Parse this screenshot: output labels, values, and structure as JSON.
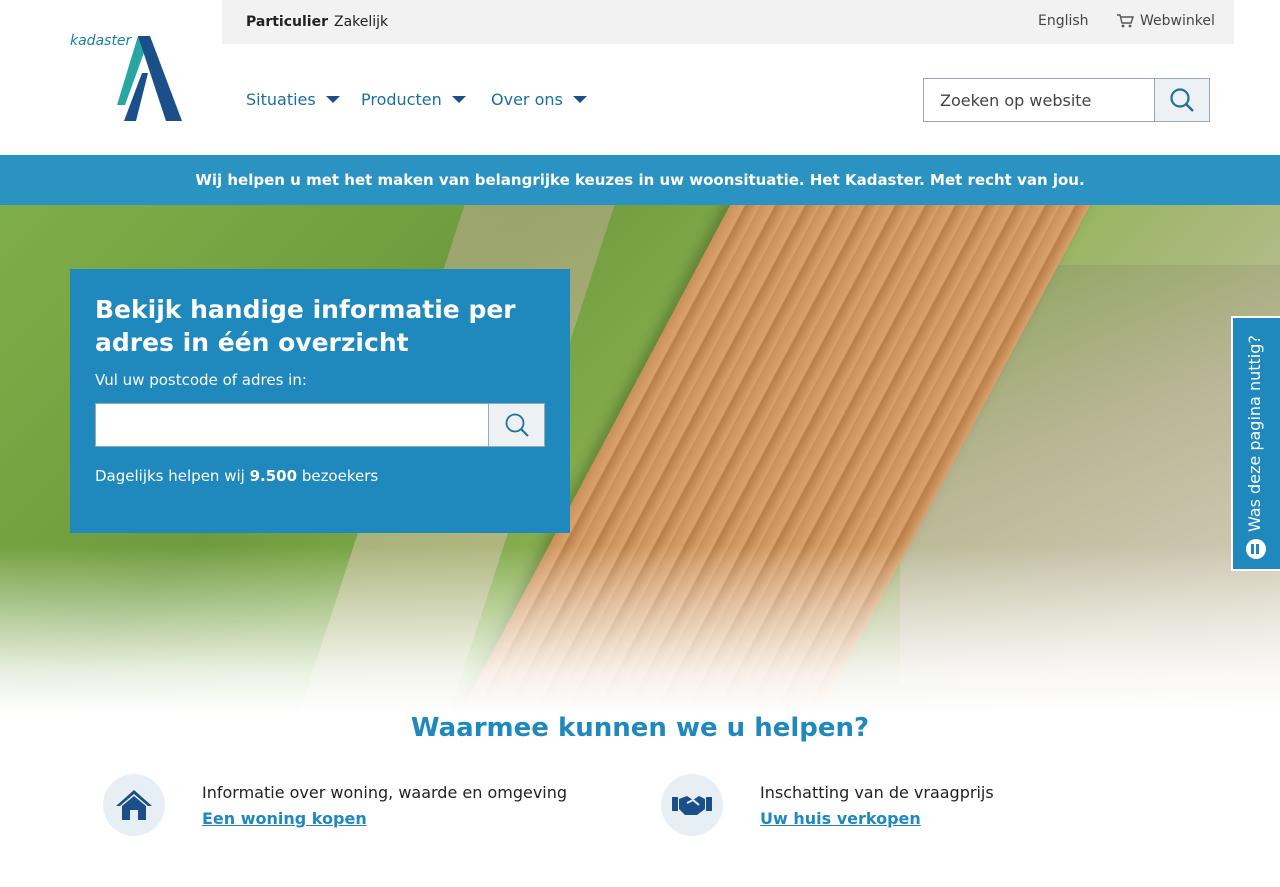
{
  "topbar": {
    "particulier": "Particulier",
    "zakelijk": "Zakelijk",
    "english": "English",
    "webwinkel": "Webwinkel"
  },
  "logo": {
    "text": "kadaster"
  },
  "nav": {
    "items": [
      {
        "label": "Situaties"
      },
      {
        "label": "Producten"
      },
      {
        "label": "Over ons"
      }
    ]
  },
  "search": {
    "placeholder": "Zoeken op website"
  },
  "banner": {
    "text": "Wij helpen u met het maken van belangrijke keuzes in uw woonsituatie. Het Kadaster. Met recht van jou."
  },
  "hero_card": {
    "title": "Bekijk handige informatie per adres in één overzicht",
    "label": "Vul uw postcode of adres in:",
    "input_value": "",
    "stats_prefix": "Dagelijks helpen wij",
    "stats_number": "9.500",
    "stats_suffix": "bezoekers"
  },
  "feedback": {
    "label": "Was deze pagina nuttig?"
  },
  "help": {
    "title": "Waarmee kunnen we u helpen?",
    "items": [
      {
        "icon": "house-icon",
        "description": "Informatie over woning, waarde en omgeving",
        "link": "Een woning kopen"
      },
      {
        "icon": "handshake-icon",
        "description": "Inschatting van de vraagprijs",
        "link": "Uw huis verkopen"
      }
    ]
  },
  "colors": {
    "brand_blue": "#1f88bd",
    "banner_blue": "#2a93c2",
    "dark_blue": "#1b4f8a"
  }
}
